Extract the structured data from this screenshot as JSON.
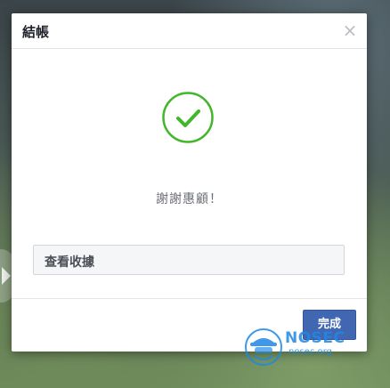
{
  "dialog": {
    "title": "結帳",
    "close_glyph": "×",
    "icon": "checkmark-circle-icon",
    "message": "謝謝惠顧！",
    "receipt_label": "查看收據",
    "done_label": "完成"
  },
  "watermark": {
    "main": "NOSEC",
    "sub": "nosec.org"
  },
  "colors": {
    "success": "#42b72a",
    "primary": "#4267b2",
    "watermark": "#1e88e5"
  }
}
